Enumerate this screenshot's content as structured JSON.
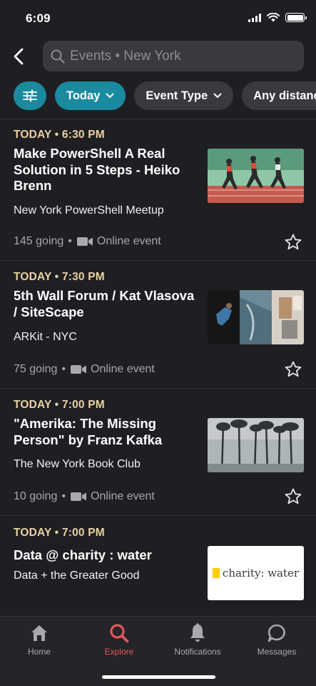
{
  "status_bar": {
    "time": "6:09"
  },
  "search": {
    "placeholder": "Events • New York"
  },
  "filters": [
    {
      "label": "Today"
    },
    {
      "label": "Event Type"
    },
    {
      "label": "Any distance"
    }
  ],
  "events": [
    {
      "when": "TODAY • 6:30 PM",
      "title": "Make PowerShell A Real Solution in 5 Steps - Heiko Brenn",
      "group": "New York PowerShell Meetup",
      "going": "145 going",
      "location": "Online event"
    },
    {
      "when": "TODAY • 7:30 PM",
      "title": "5th Wall Forum / Kat Vlasova / SiteScape",
      "group": "ARKit - NYC",
      "going": "75 going",
      "location": "Online event"
    },
    {
      "when": "TODAY • 7:00 PM",
      "title": "\"Amerika: The Missing Person\" by Franz Kafka",
      "group": "The New York Book Club",
      "going": "10 going",
      "location": "Online event"
    },
    {
      "when": "TODAY • 7:00 PM",
      "title": "Data @ charity : water",
      "group": "Data + the Greater Good",
      "thumb_text": "charity: water"
    }
  ],
  "tabs": [
    {
      "label": "Home",
      "icon": "home-icon"
    },
    {
      "label": "Explore",
      "icon": "search-icon"
    },
    {
      "label": "Notifications",
      "icon": "bell-icon"
    },
    {
      "label": "Messages",
      "icon": "chat-icon"
    }
  ],
  "colors": {
    "background": "#1f1e22",
    "accent_teal": "#1a8a9f",
    "time_label": "#e9d2a3",
    "active_tab": "#e2585b"
  },
  "separator": "•"
}
